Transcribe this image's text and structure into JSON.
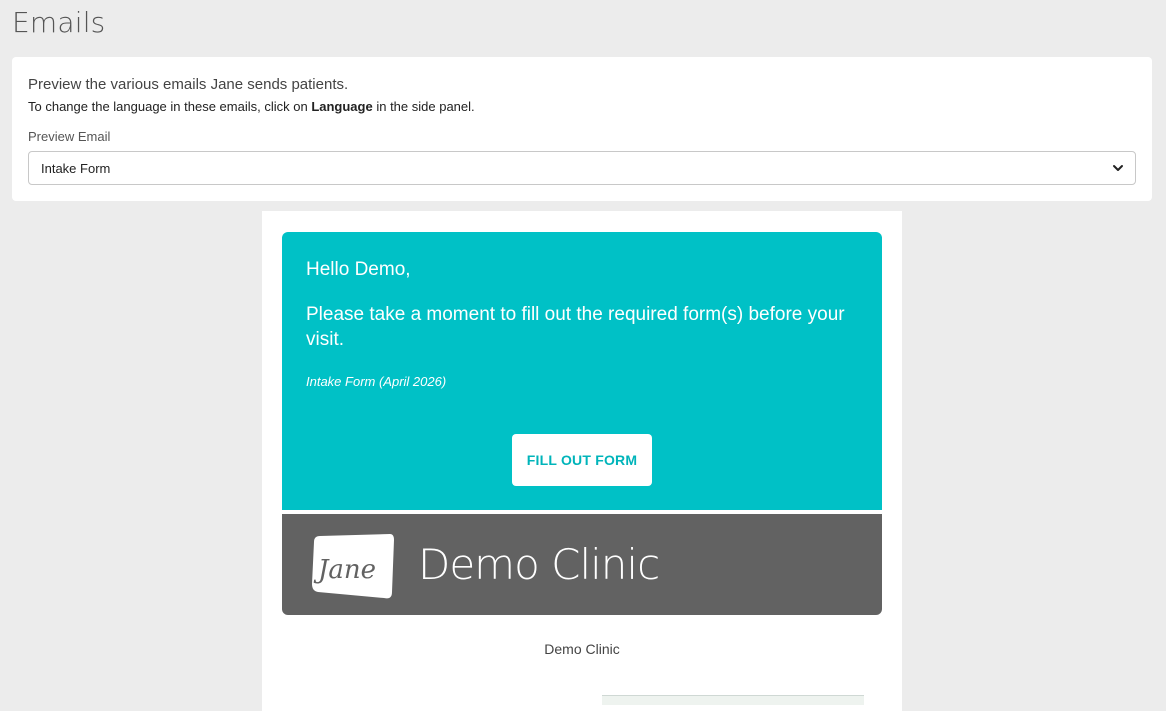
{
  "page": {
    "title": "Emails"
  },
  "panel": {
    "intro": "Preview the various emails Jane sends patients.",
    "hint_before": "To change the language in these emails, click on",
    "hint_bold": "Language",
    "hint_after": "in the side panel.",
    "select_label": "Preview Email",
    "select_value": "Intake Form"
  },
  "email": {
    "greeting": "Hello Demo,",
    "message": "Please take a moment to fill out the required form(s) before your visit.",
    "form_name": "Intake Form (April 2026)",
    "button_label": "FILL OUT FORM",
    "logo_text": "Jane",
    "brand_clinic_name": "Demo Clinic",
    "footer_clinic_name": "Demo Clinic"
  },
  "colors": {
    "hero": "#00c1c6",
    "brand_bar": "#626262",
    "button_text": "#00b4ba"
  },
  "icons": {
    "select_arrow": "chevron-down-icon",
    "logo": "jane-logo"
  }
}
